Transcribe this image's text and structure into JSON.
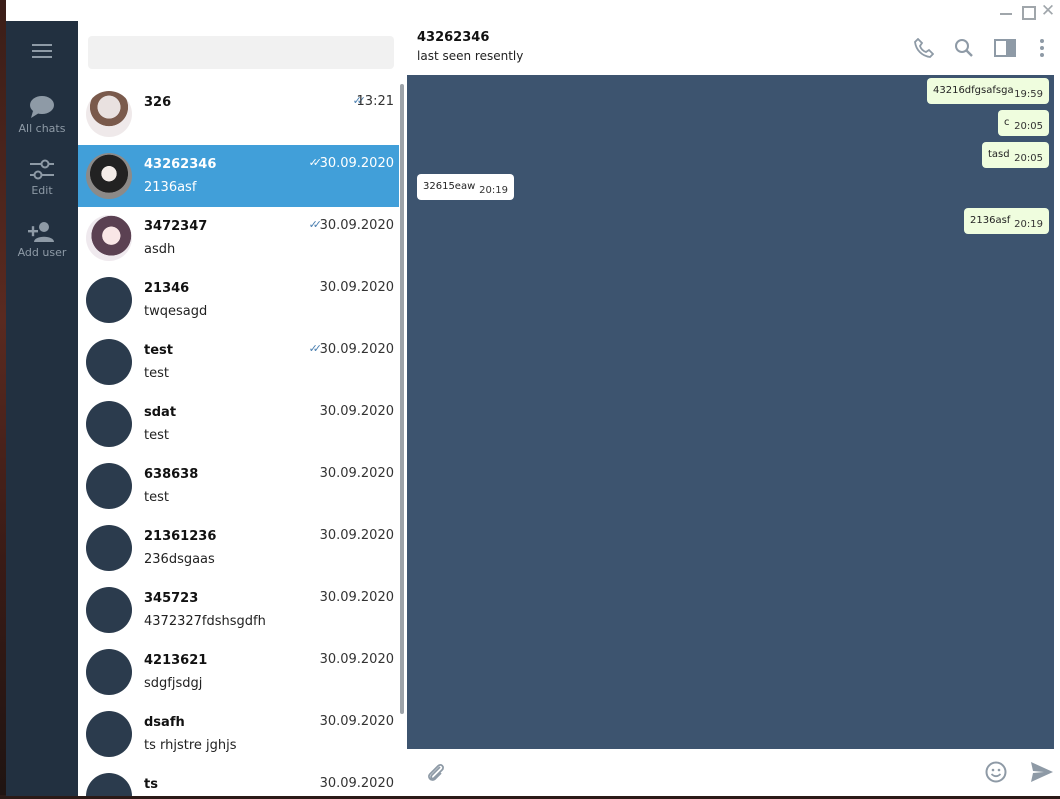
{
  "window": {
    "title_buttons": [
      "minimize-icon",
      "maximize-icon",
      "close-icon"
    ],
    "close_glyph": "✕"
  },
  "nav": {
    "items": [
      {
        "label": "All chats",
        "icon": "chat-bubble-icon"
      },
      {
        "label": "Edit",
        "icon": "sliders-icon"
      },
      {
        "label": "Add user",
        "icon": "add-user-icon"
      }
    ]
  },
  "search": {
    "placeholder": ""
  },
  "chats": [
    {
      "name": "326",
      "preview": "",
      "date": "13:21",
      "read": true,
      "avatar": "img1"
    },
    {
      "name": "43262346",
      "preview": "2136asf",
      "date": "30.09.2020",
      "read": true,
      "avatar": "img2",
      "selected": true
    },
    {
      "name": "3472347",
      "preview": "asdh",
      "date": "30.09.2020",
      "read": true,
      "avatar": "img3"
    },
    {
      "name": "21346",
      "preview": "twqesagd",
      "date": "30.09.2020",
      "read": false,
      "avatar": "none"
    },
    {
      "name": "test",
      "preview": "test",
      "date": "30.09.2020",
      "read": true,
      "avatar": "none"
    },
    {
      "name": "sdat",
      "preview": "test",
      "date": "30.09.2020",
      "read": false,
      "avatar": "none"
    },
    {
      "name": "638638",
      "preview": "test",
      "date": "30.09.2020",
      "read": false,
      "avatar": "none"
    },
    {
      "name": "21361236",
      "preview": "236dsgaas",
      "date": "30.09.2020",
      "read": false,
      "avatar": "none"
    },
    {
      "name": "345723",
      "preview": "4372327fdshsgdfh",
      "date": "30.09.2020",
      "read": false,
      "avatar": "none"
    },
    {
      "name": "4213621",
      "preview": "sdgfjsdgj",
      "date": "30.09.2020",
      "read": false,
      "avatar": "none"
    },
    {
      "name": "dsafh",
      "preview": "ts rhjstre jghjs",
      "date": "30.09.2020",
      "read": false,
      "avatar": "none"
    },
    {
      "name": "ts",
      "preview": "",
      "date": "30.09.2020",
      "read": false,
      "avatar": "none"
    }
  ],
  "conversation": {
    "title": "43262346",
    "status": "last seen resently",
    "header_icons": [
      "phone-icon",
      "search-icon",
      "sidebar-toggle-icon",
      "more-vertical-icon"
    ],
    "messages": [
      {
        "text": "43216dfgsafsga",
        "time": "19:59",
        "direction": "out"
      },
      {
        "text": "c",
        "time": "20:05",
        "direction": "out"
      },
      {
        "text": "tasd",
        "time": "20:05",
        "direction": "out"
      },
      {
        "text": "32615eaw",
        "time": "20:19",
        "direction": "in"
      },
      {
        "text": "2136asf",
        "time": "20:19",
        "direction": "out"
      }
    ]
  },
  "composer": {
    "placeholder": "",
    "icons": [
      "attach-icon",
      "emoji-icon",
      "send-icon"
    ]
  },
  "colors": {
    "nav_bg": "#223040",
    "selected_row": "#419fd9",
    "chat_bg": "#3d546f",
    "outgoing_bubble": "#effdde",
    "incoming_bubble": "#ffffff",
    "accent": "#5e9bd0"
  }
}
